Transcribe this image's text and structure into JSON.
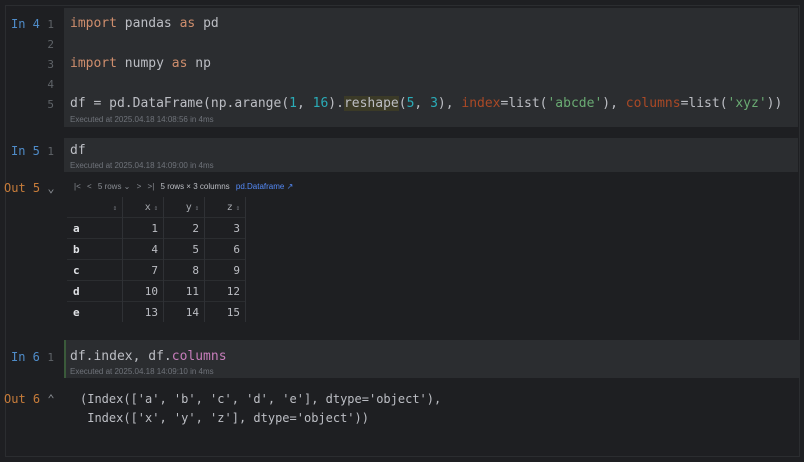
{
  "cells": {
    "in4": {
      "label": "In 4",
      "line_numbers": [
        "1",
        "2",
        "3",
        "4",
        "5"
      ],
      "line1": {
        "kw1": "import",
        "mid": " pandas ",
        "kw2": "as",
        "end": " pd"
      },
      "line3": {
        "kw1": "import",
        "mid": " numpy ",
        "kw2": "as",
        "end": " np"
      },
      "line5": {
        "p1": "df = pd.DataFrame(np.arange(",
        "n1": "1",
        "p2": ", ",
        "n2": "16",
        "p3": ").",
        "hl": "reshape",
        "p4": "(",
        "n3": "5",
        "p5": ", ",
        "n4": "3",
        "p6": "), ",
        "kwarg1": "index",
        "p7": "=list(",
        "s1": "'abcde'",
        "p8": "), ",
        "kwarg2": "columns",
        "p9": "=list(",
        "s2": "'xyz'",
        "p10": "))"
      },
      "executed": "Executed at 2025.04.18 14:08:56 in 4ms"
    },
    "in5": {
      "label": "In 5",
      "line_number": "1",
      "code": "df",
      "executed": "Executed at 2025.04.18 14:09:00 in 4ms"
    },
    "out5": {
      "label": "Out 5",
      "chevron": "⌄",
      "toolbar": {
        "first": "|<",
        "prev": "<",
        "rows_select": "5 rows ⌄",
        "next": ">",
        "last": ">|",
        "summary": "5 rows × 3 columns",
        "link": "pd.Dataframe ↗"
      },
      "table": {
        "headers": [
          "",
          "x",
          "y",
          "z"
        ],
        "sort_glyph": "⇕",
        "rows": [
          {
            "index": "a",
            "values": [
              "1",
              "2",
              "3"
            ]
          },
          {
            "index": "b",
            "values": [
              "4",
              "5",
              "6"
            ]
          },
          {
            "index": "c",
            "values": [
              "7",
              "8",
              "9"
            ]
          },
          {
            "index": "d",
            "values": [
              "10",
              "11",
              "12"
            ]
          },
          {
            "index": "e",
            "values": [
              "13",
              "14",
              "15"
            ]
          }
        ]
      }
    },
    "in6": {
      "label": "In 6",
      "line_number": "1",
      "code_a": "df.index, df.",
      "code_b": "columns",
      "executed": "Executed at 2025.04.18 14:09:10 in 4ms"
    },
    "out6": {
      "label": "Out 6",
      "chevron": "⌃",
      "line1": "(Index(['a', 'b', 'c', 'd', 'e'], dtype='object'),",
      "line2": " Index(['x', 'y', 'z'], dtype='object'))"
    }
  }
}
